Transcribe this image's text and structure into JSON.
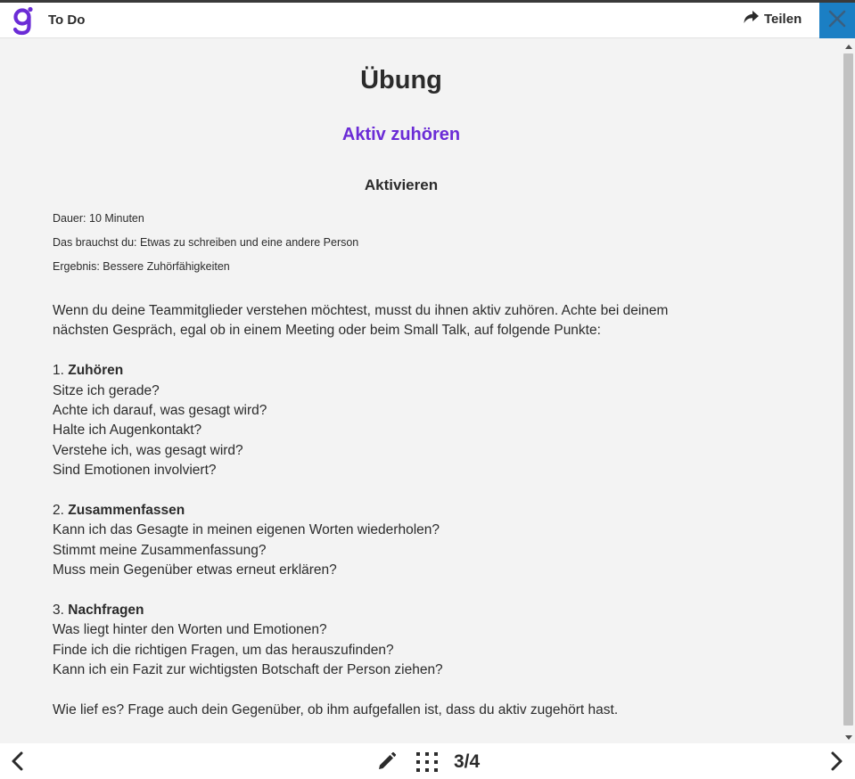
{
  "header": {
    "app_title": "To Do",
    "share_label": "Teilen"
  },
  "exercise": {
    "title": "Übung",
    "subtitle": "Aktiv zuhören",
    "section_heading": "Aktivieren",
    "meta": {
      "duration": "Dauer: 10 Minuten",
      "needs": "Das brauchst du: Etwas zu schreiben und eine andere Person",
      "result": "Ergebnis: Bessere Zuhörfähigkeiten"
    },
    "intro": [
      "Wenn du deine Teammitglieder verstehen möchtest, musst du ihnen aktiv zuhören. Achte bei deinem",
      "nächsten Gespräch, egal ob in einem Meeting oder beim Small Talk, auf folgende Punkte:"
    ],
    "steps": [
      {
        "number": "1.",
        "heading": "Zuhören",
        "questions": [
          "Sitze ich gerade?",
          "Achte ich darauf, was gesagt wird?",
          "Halte ich Augenkontakt?",
          "Verstehe ich, was gesagt wird?",
          "Sind Emotionen involviert?"
        ]
      },
      {
        "number": "2.",
        "heading": "Zusammenfassen",
        "questions": [
          "Kann ich das Gesagte in meinen eigenen Worten wiederholen?",
          "Stimmt meine Zusammenfassung?",
          "Muss mein Gegenüber etwas erneut erklären?"
        ]
      },
      {
        "number": "3.",
        "heading": "Nachfragen",
        "questions": [
          "Was liegt hinter den Worten und Emotionen?",
          "Finde ich die richtigen Fragen, um das herauszufinden?",
          "Kann ich ein Fazit zur wichtigsten Botschaft der Person ziehen?"
        ]
      }
    ],
    "closing": "Wie lief es? Frage auch dein Gegenüber, ob ihm aufgefallen ist, dass du aktiv zugehört hast."
  },
  "footer": {
    "page_counter": "3/4"
  },
  "icons": {
    "logo": "brand-g-logo-icon",
    "share": "share-arrow-icon",
    "close": "close-icon",
    "prev": "chevron-left-icon",
    "next": "chevron-right-icon",
    "edit": "pencil-icon",
    "overview": "grid-dots-icon"
  },
  "colors": {
    "accent_purple": "#6b2cd6",
    "close_blue": "#1b7fc4",
    "text": "#2b2b2b",
    "background": "#f3f3f3"
  }
}
